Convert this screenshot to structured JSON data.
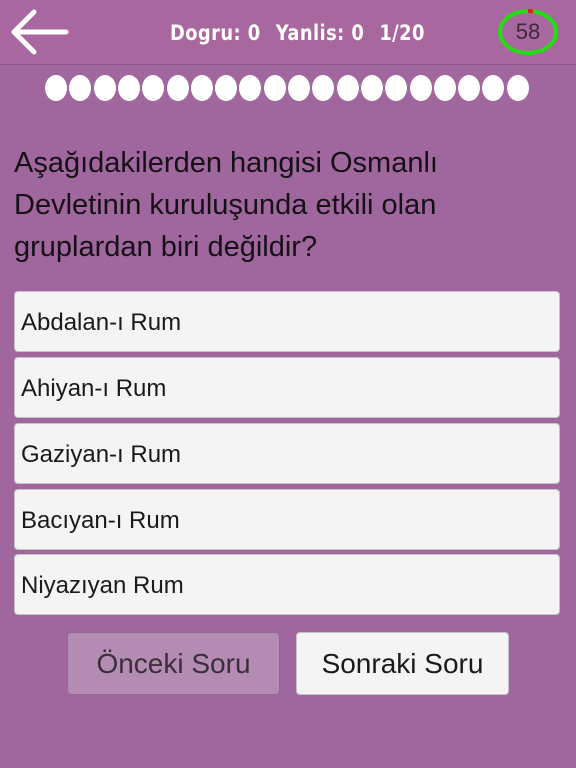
{
  "header": {
    "back_icon": "arrow-left-icon",
    "correct_label": "Dogru: 0",
    "wrong_label": "Yanlis: 0",
    "question_counter": "1/20",
    "timer_value": "58",
    "timer_ring_color": "#22dd11",
    "timer_elapsed_color": "#dd2222"
  },
  "progress": {
    "total": 20,
    "current": 1
  },
  "question": {
    "text": "Aşağıdakilerden hangisi Osmanlı Devletinin kuruluşunda etkili olan gruplardan biri değildir?"
  },
  "options": [
    {
      "label": "Abdalan-ı Rum"
    },
    {
      "label": "Ahiyan-ı Rum"
    },
    {
      "label": "Gaziyan-ı Rum"
    },
    {
      "label": "Bacıyan-ı Rum"
    },
    {
      "label": "Niyazıyan Rum"
    }
  ],
  "navigation": {
    "prev_label": "Önceki Soru",
    "next_label": "Sonraki Soru"
  },
  "colors": {
    "background": "#a0679f",
    "option_background": "#f4f4f4"
  }
}
